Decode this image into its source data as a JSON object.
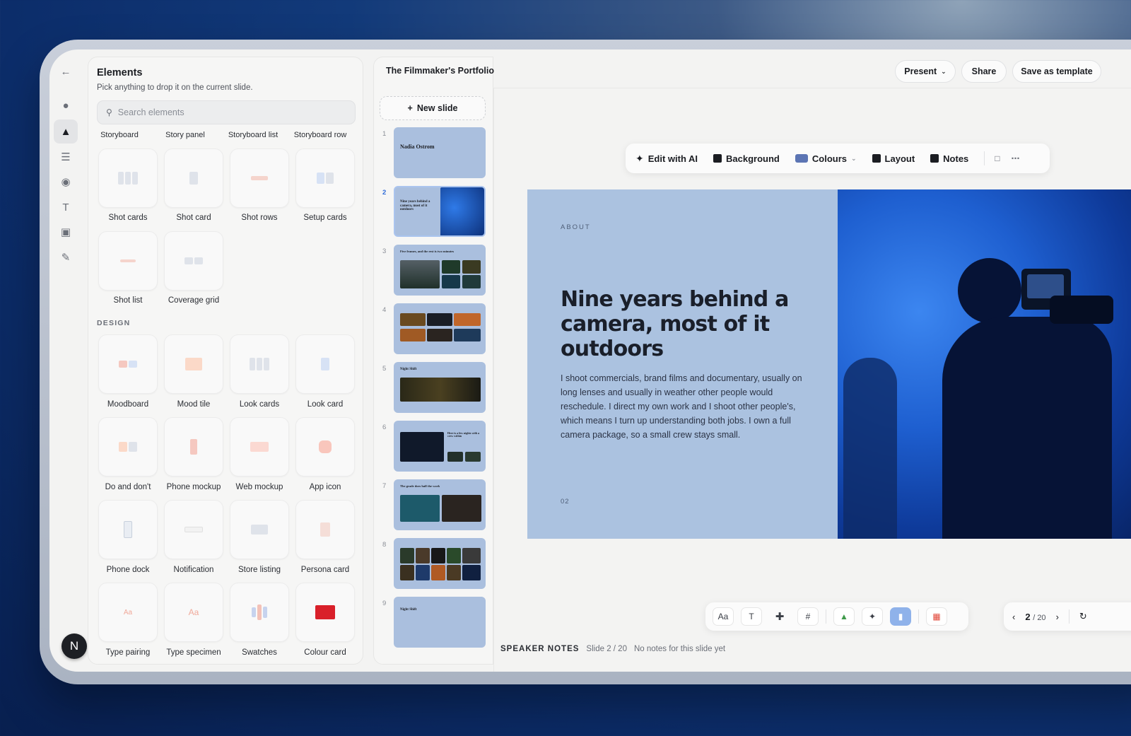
{
  "app": {
    "doc_title": "The Filmmaker's Portfolio",
    "user_initial": "N"
  },
  "header": {
    "present_label": "Present",
    "share_label": "Share",
    "save_template_label": "Save as template"
  },
  "elements_panel": {
    "title": "Elements",
    "subtitle": "Pick anything to drop it on the current slide.",
    "search_placeholder": "Search elements",
    "top_categories": [
      "Storyboard",
      "Story panel",
      "Storyboard list",
      "Storyboard row"
    ],
    "storyboard_items": [
      "Shot cards",
      "Shot card",
      "Shot rows",
      "Setup cards",
      "Shot list",
      "Coverage grid"
    ],
    "design_section": "DESIGN",
    "design_items": [
      "Moodboard",
      "Mood tile",
      "Look cards",
      "Look card",
      "Do and don't",
      "Phone mockup",
      "Web mockup",
      "App icon",
      "Phone dock",
      "Notification",
      "Store listing",
      "Persona card",
      "Type pairing",
      "Type specimen",
      "Swatches",
      "Colour card"
    ]
  },
  "slides_strip": {
    "new_slide_label": "New slide",
    "numbers": [
      "1",
      "2",
      "3",
      "4",
      "5",
      "6",
      "7",
      "8",
      "9"
    ],
    "active_index": 1,
    "thumb_titles": [
      "Nadia Ostrom",
      "Nine years behind a camera, most of it outdoors",
      "Five frames, and the rest is two minutes",
      "",
      "Night Shift",
      "Here is a few nights with a crew within",
      "The grade does half the work",
      "",
      "Night Shift"
    ]
  },
  "toolbar": {
    "edit_ai": "Edit with AI",
    "background": "Background",
    "colours": "Colours",
    "layout": "Layout",
    "notes": "Notes"
  },
  "slide": {
    "eyebrow": "ABOUT",
    "heading": "Nine years behind a camera, most of it outdoors",
    "body": "I shoot commercials, brand films and documentary, usually on long lenses and usually in weather other people would reschedule. I direct my own work and I shoot other people's, which means I turn up understanding both jobs. I own a full camera package, so a small crew stays small.",
    "page_number": "02",
    "bg_color": "#abc2e0"
  },
  "bottom_tools": [
    "Aa",
    "T",
    "/",
    "#",
    "shapes",
    "spark",
    "chart",
    "apps"
  ],
  "pager": {
    "current": "2",
    "total": "/ 20"
  },
  "speaker_notes": {
    "label": "SPEAKER NOTES",
    "slide_info": "Slide 2 / 20",
    "empty_text": "No notes for this slide yet"
  }
}
